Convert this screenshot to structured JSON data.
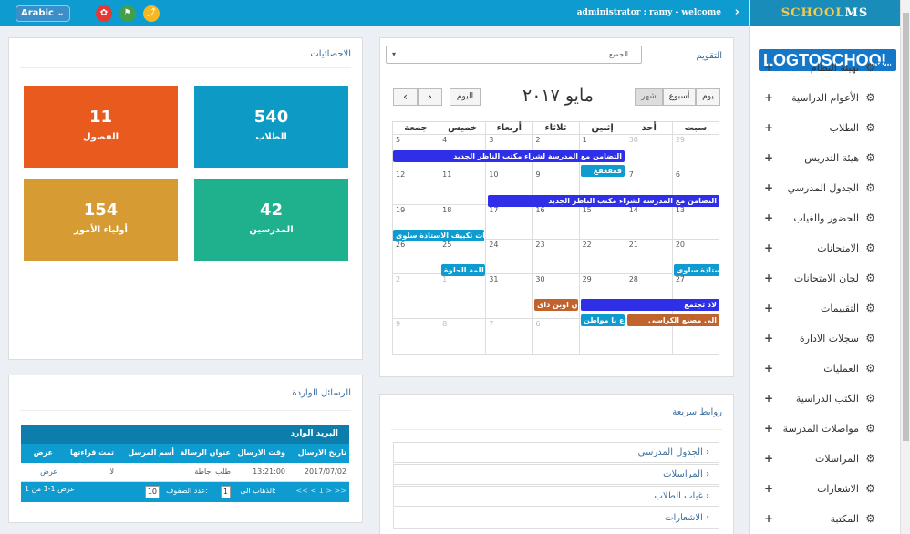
{
  "topbar": {
    "language": "Arabic ⌄",
    "welcome": "administrator : ramy - welcome",
    "collapse_icon": "chevron-right-icon",
    "buttons": [
      {
        "icon": "gear-icon",
        "glyph": "✿",
        "color": "#e53935"
      },
      {
        "icon": "flag-icon",
        "glyph": "⚑",
        "color": "#43a047"
      },
      {
        "icon": "chart-icon",
        "glyph": "⤴",
        "color": "#f6b723"
      }
    ]
  },
  "sidebar": {
    "brand_a": "SCHOOL",
    "brand_b": "MS",
    "logo_main": "LOGTOSCHOOL",
    "logo_com": ".com",
    "items": [
      {
        "label": "تهيئة النظام"
      },
      {
        "label": "الأعوام الدراسية"
      },
      {
        "label": "الطلاب"
      },
      {
        "label": "هيئة التدريس"
      },
      {
        "label": "الجدول المدرسي"
      },
      {
        "label": "الحضور والغياب"
      },
      {
        "label": "الامتحانات"
      },
      {
        "label": "لجان الامتحانات"
      },
      {
        "label": "التقييمات"
      },
      {
        "label": "سجلات الادارة"
      },
      {
        "label": "العمليات"
      },
      {
        "label": "الكتب الدراسية"
      },
      {
        "label": "مواصلات المدرسة"
      },
      {
        "label": "المراسلات"
      },
      {
        "label": "الاشعارات"
      },
      {
        "label": "المكتبة"
      }
    ]
  },
  "stats": {
    "title": "الاحصائيات",
    "tiles": [
      {
        "num": "540",
        "label": "الطلاب",
        "color": "#0d9bc6"
      },
      {
        "num": "11",
        "label": "الفصول",
        "color": "#e95a1f"
      },
      {
        "num": "42",
        "label": "المدرسين",
        "color": "#1fb08e"
      },
      {
        "num": "154",
        "label": "أولياء الأمور",
        "color": "#d69b32"
      }
    ]
  },
  "calendar": {
    "title": "التقويم",
    "select_value": "الجميع",
    "month_title": "مايو ٢٠١٧",
    "today": "اليوم",
    "prev": "‹",
    "next": "›",
    "views": [
      "يوم",
      "أسبوع",
      "شهر"
    ],
    "weekdays": [
      "سبت",
      "أحد",
      "إثنين",
      "ثلاثاء",
      "أربعاء",
      "خميس",
      "جمعة"
    ],
    "weeks": [
      [
        "29",
        "30",
        "1",
        "2",
        "3",
        "4",
        "5"
      ],
      [
        "6",
        "7",
        "8",
        "9",
        "10",
        "11",
        "12"
      ],
      [
        "13",
        "14",
        "15",
        "16",
        "17",
        "18",
        "19"
      ],
      [
        "20",
        "21",
        "22",
        "23",
        "24",
        "25",
        "26"
      ],
      [
        "27",
        "28",
        "29",
        "30",
        "31",
        "1",
        "2"
      ],
      [
        "3",
        "4",
        "5",
        "6",
        "7",
        "8",
        "9"
      ]
    ],
    "events": [
      {
        "text": "التضامن مع المدرسة لشراء مكتب الناظر الجديد",
        "color": "#2f2fe8"
      },
      {
        "text": "فغفغفغ",
        "color": "#0d9bd0"
      },
      {
        "text": "التضامن مع المدرسة لشراء مكتب الناظر الجديد",
        "color": "#2f2fe8"
      },
      {
        "text": "نفات تكييف الاستاذة سلوى",
        "color": "#0d9bd0"
      },
      {
        "text": "تكلفة الاستاذة سلوى",
        "color": "#0d9bd0"
      },
      {
        "text": "للمة الحلوة",
        "color": "#0d9bd0"
      },
      {
        "text": "لاد تجتمع",
        "color": "#2f2fe8"
      },
      {
        "text": "الى مصنع الكراسى",
        "color": "#c0632c"
      },
      {
        "text": "ن اوبن داى",
        "color": "#c0632c"
      },
      {
        "text": "ع يا مواطن",
        "color": "#0d9bd0"
      }
    ]
  },
  "inbox": {
    "title": "الرسائل الواردة",
    "header": "البريد الوارد",
    "columns": [
      "تاريخ الارسال",
      "وقت الارسال",
      "عنوان الرسالة",
      "أسم المرسل",
      "تمت قراءتها",
      "عرض"
    ],
    "row": [
      "2017/07/02",
      "13:21:00",
      "طلب اجاطة",
      "",
      "لا",
      "عرض"
    ],
    "goto_label": "الذهاب الى:",
    "goto_value": "1",
    "rows_label": "عدد الصفوف:",
    "rows_value": "10",
    "pager": "<< < 1 > >>",
    "range": "عرض 1-1 من 1"
  },
  "quicklinks": {
    "title": "روابط سريعة",
    "items": [
      "الجدول المدرسي",
      "المراسلات",
      "غياب الطلاب",
      "الاشعارات"
    ]
  }
}
